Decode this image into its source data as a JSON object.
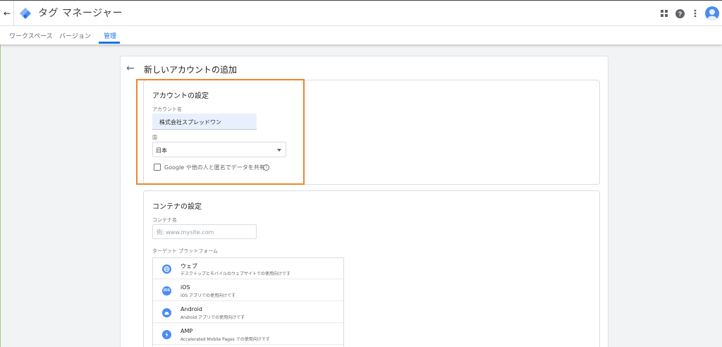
{
  "header": {
    "app_title": "タグ マネージャー",
    "back_icon": "arrow-back-icon",
    "logo_icon": "tag-manager-logo-icon",
    "apps_icon": "apps-grid-icon",
    "help_icon": "help-icon",
    "more_icon": "more-vert-icon",
    "avatar_icon": "account-avatar-icon"
  },
  "tabs": [
    {
      "label": "ワークスペース",
      "active": false
    },
    {
      "label": "バージョン",
      "active": false
    },
    {
      "label": "管理",
      "active": true
    }
  ],
  "panel": {
    "back_glyph": "←",
    "title": "新しいアカウントの追加"
  },
  "account_settings": {
    "title": "アカウントの設定",
    "account_name_label": "アカウント名",
    "account_name_value": "株式会社スプレッドワン",
    "country_label": "国",
    "country_value": "日本",
    "share_label": "Google や他の人と匿名でデータを共有",
    "share_checked": false
  },
  "container_settings": {
    "title": "コンテナの設定",
    "container_name_label": "コンテナ名",
    "container_name_placeholder": "例: www.mysite.com",
    "platform_label": "ターゲット プラットフォーム",
    "platforms": [
      {
        "icon": "web-globe-icon",
        "title": "ウェブ",
        "desc": "デスクトップとモバイルのウェブサイトでの使用向けです"
      },
      {
        "icon": "ios-icon",
        "title": "iOS",
        "desc": "iOS アプリでの使用向けです"
      },
      {
        "icon": "android-icon",
        "title": "Android",
        "desc": "Android アプリでの使用向けです"
      },
      {
        "icon": "amp-bolt-icon",
        "title": "AMP",
        "desc": "Accelerated Mobile Pages での使用向けです"
      }
    ]
  },
  "colors": {
    "accent": "#1a73e8",
    "highlight": "#f0852d",
    "icon_blue": "#4a8af4"
  }
}
